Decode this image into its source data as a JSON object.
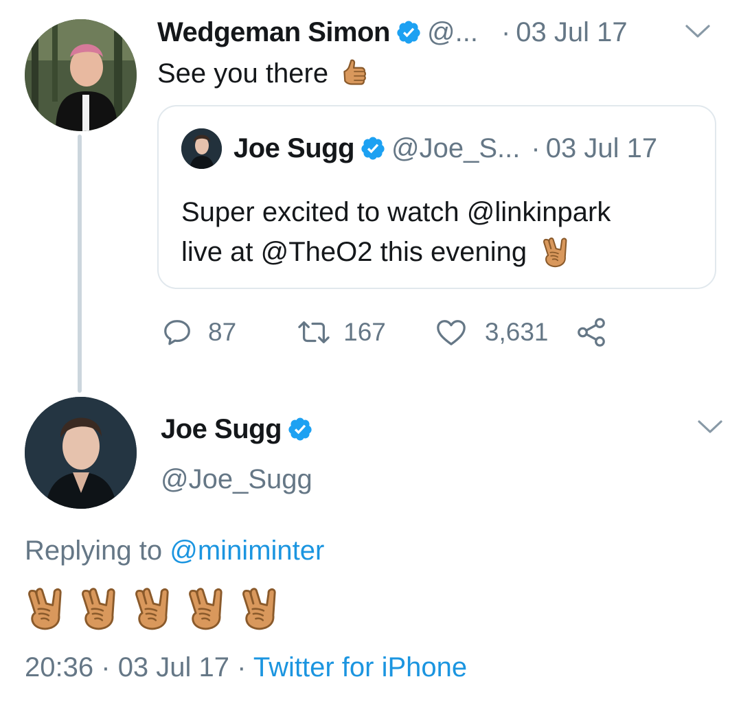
{
  "thread": {
    "tweet1": {
      "name": "Wedgeman Simon",
      "handle": "@...",
      "separator": "·",
      "date": "03 Jul 17",
      "text": "See you there",
      "emoji_icon": "thumbs-up-emoji"
    },
    "quote": {
      "name": "Joe Sugg",
      "handle": "@Joe_S...",
      "separator": "·",
      "date": "03 Jul 17",
      "text_line1": "Super excited to watch @linkinpark",
      "text_line2": "live at @TheO2 this evening",
      "emoji_icon": "rock-on-hand-emoji"
    },
    "actions": {
      "replies": "87",
      "retweets": "167",
      "likes": "3,631"
    }
  },
  "tweet2": {
    "name": "Joe Sugg",
    "handle": "@Joe_Sugg",
    "replying_prefix": "Replying to",
    "replying_to": "@miniminter",
    "emoji_icon": "rock-on-hand-emoji",
    "emoji_count": 5,
    "time": "20:36",
    "date": "03 Jul 17",
    "separator": "·",
    "source": "Twitter for iPhone"
  },
  "colors": {
    "verified": "#1da1f2",
    "link": "#1b95e0",
    "muted": "#657786",
    "text": "#14171a",
    "border": "#e1e8ed",
    "thread_line": "#ccd6dd"
  }
}
